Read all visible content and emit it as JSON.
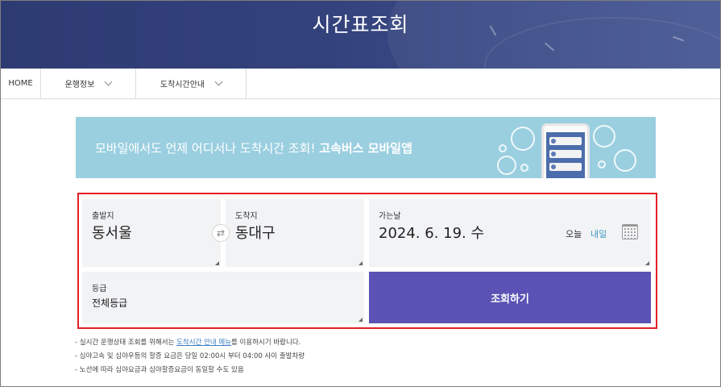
{
  "header": {
    "title": "시간표조회"
  },
  "nav": {
    "home": "HOME",
    "items": [
      {
        "label": "운행정보"
      },
      {
        "label": "도착시간안내"
      }
    ]
  },
  "promo": {
    "text": "모바일에서도 언제 어디서나 도착시간 조회!",
    "highlight": "고속버스 모바일앱"
  },
  "search": {
    "departure": {
      "label": "출발지",
      "value": "동서울"
    },
    "arrival": {
      "label": "도착지",
      "value": "동대구"
    },
    "date": {
      "label": "가는날",
      "value": "2024. 6. 19. 수",
      "today": "오늘",
      "tomorrow": "내일"
    },
    "grade": {
      "label": "등급",
      "value": "전체등급"
    },
    "submit": "조회하기",
    "swap_icon": "⇄"
  },
  "notes": {
    "line1_pre": "- 실시간 운행상태 조회를 위해서는 ",
    "line1_link": "도착시간 안내 메뉴",
    "line1_post": "를 이용하시기 바랍니다.",
    "line2": "- 심야고속 및 심야우등의 할증 요금은 당일 02:00시 부터 04:00 사이 출발차량",
    "line3": "- 노선에 따라 심야요금과 심야할증요금이 동일할 수도 있음"
  },
  "colors": {
    "accent": "#5a52b4",
    "highlight_border": "#e31e24",
    "promo_bg": "#9acfe0",
    "header_bg": "#2e3b73"
  }
}
